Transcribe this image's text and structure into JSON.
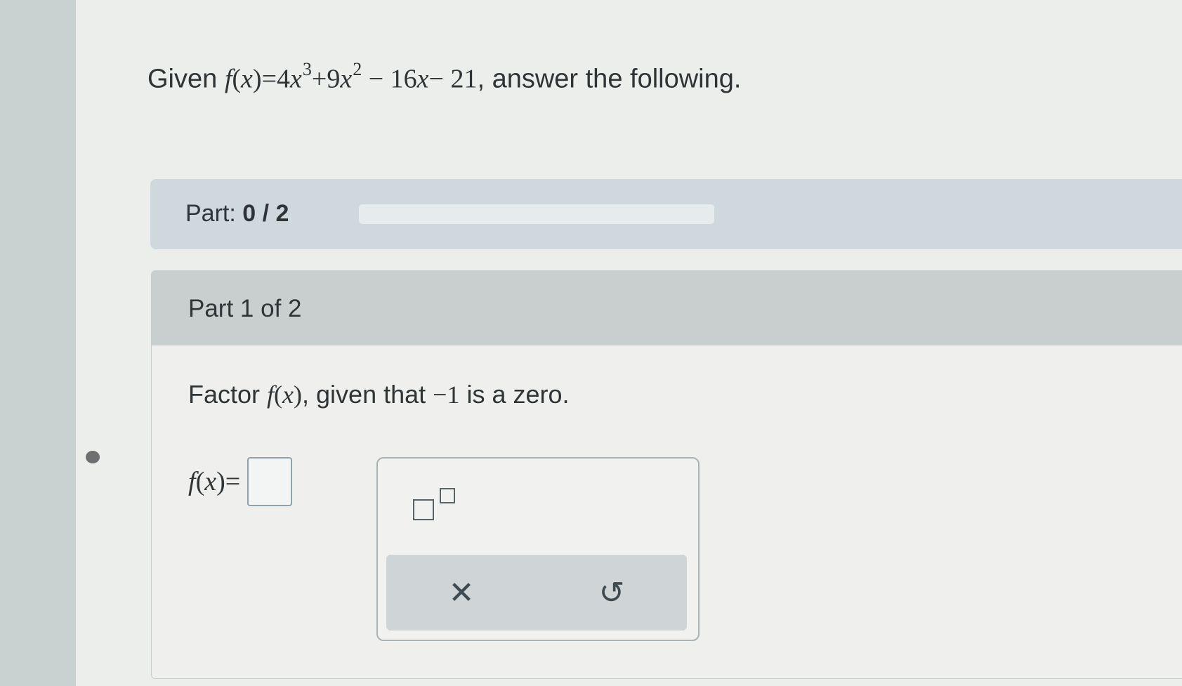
{
  "question": {
    "prefix": "Given ",
    "func": "f",
    "var": "x",
    "coef3": "4",
    "exp3": "3",
    "op2": "+9",
    "exp2": "2",
    "tail": " − 16",
    "tail2": "− 21",
    "suffix": ", answer the following."
  },
  "progress": {
    "label": "Part: ",
    "completed": "0",
    "separator": " / ",
    "total": "2",
    "fraction": 0
  },
  "part": {
    "header": "Part 1 of 2",
    "instruction_prefix": "Factor ",
    "instruction_mid": ", given that ",
    "zero_value": "−1",
    "instruction_suffix": " is a zero.",
    "answer_label_func": "f",
    "answer_label_var": "x",
    "answer_equals": "="
  },
  "keypad": {
    "superscript_icon": "superscript-icon",
    "clear_symbol": "✕",
    "undo_symbol": "↺"
  }
}
